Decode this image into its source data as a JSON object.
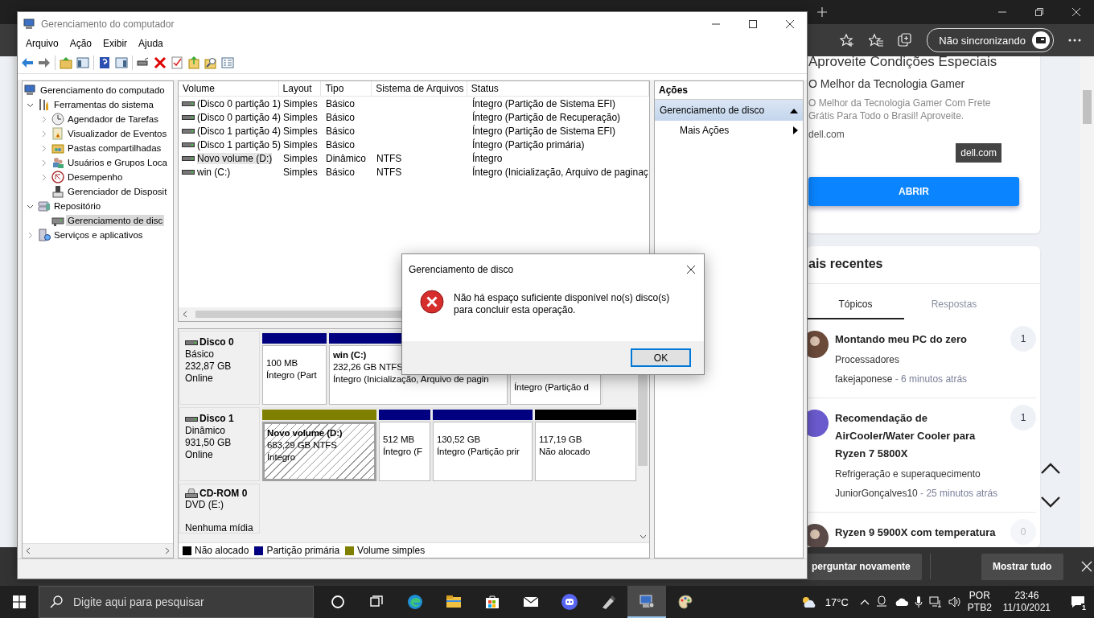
{
  "browser": {
    "sync_button": "Não sincronizando",
    "ad": {
      "title": "Aproveite Condições Especiais",
      "subtitle": "O Melhor da Tecnologia Gamer",
      "text": "O Melhor da Tecnologia Gamer Com Frete Grátis Para Todo o Brasil! Aproveite.",
      "domain": "dell.com",
      "badge": "dell.com",
      "button": "ABRIR"
    },
    "recent": {
      "heading": "ais recentes",
      "tabs": [
        {
          "label": "Tópicos",
          "selected": true
        },
        {
          "label": "Respostas",
          "selected": false
        }
      ],
      "topics": [
        {
          "title": "Montando meu PC do zero",
          "category": "Processadores",
          "author": "fakejaponese",
          "time": " - 6 minutos atrás",
          "count": "1"
        },
        {
          "title": "Recomendação de AirCooler/Water Cooler para Ryzen 7 5800X",
          "category": "Refrigeração e superaquecimento",
          "author": "JuniorGonçalves10",
          "time": " - 25 minutos atrás",
          "count": "1"
        },
        {
          "title": "Ryzen 9 5900X com temperatura",
          "count": "0"
        }
      ]
    },
    "download_bar": {
      "ask_again_button": "perguntar novamente",
      "show_all_button": "Mostrar tudo"
    }
  },
  "mmc": {
    "title": "Gerenciamento do computador",
    "menu": [
      "Arquivo",
      "Ação",
      "Exibir",
      "Ajuda"
    ],
    "tree": [
      {
        "label": "Gerenciamento do computado",
        "selected": false,
        "children": [
          {
            "label": "Ferramentas do sistema",
            "expanded": true,
            "selected": false,
            "children": [
              {
                "label": "Agendador de Tarefas",
                "expanded": false,
                "selected": false
              },
              {
                "label": "Visualizador de Eventos",
                "expanded": false,
                "selected": false
              },
              {
                "label": "Pastas compartilhadas",
                "expanded": false,
                "selected": false
              },
              {
                "label": "Usuários e Grupos Loca",
                "expanded": false,
                "selected": false
              },
              {
                "label": "Desempenho",
                "expanded": false,
                "selected": false
              },
              {
                "label": "Gerenciador de Disposit",
                "selected": false
              }
            ]
          },
          {
            "label": "Repositório",
            "expanded": true,
            "selected": false,
            "children": [
              {
                "label": "Gerenciamento de disc",
                "selected": true
              }
            ]
          },
          {
            "label": "Serviços e aplicativos",
            "expanded": false,
            "selected": false
          }
        ]
      }
    ],
    "volume_table": {
      "columns": [
        "Volume",
        "Layout",
        "Tipo",
        "Sistema de Arquivos",
        "Status"
      ],
      "rows": [
        {
          "cells": [
            "(Disco 0 partição 1)",
            "Simples",
            "Básico",
            "",
            "Íntegro (Partição de Sistema EFI)"
          ],
          "selected": false
        },
        {
          "cells": [
            "(Disco 0 partição 4)",
            "Simples",
            "Básico",
            "",
            "Íntegro (Partição de Recuperação)"
          ],
          "selected": false
        },
        {
          "cells": [
            "(Disco 1 partição 4)",
            "Simples",
            "Básico",
            "",
            "Íntegro (Partição de Sistema EFI)"
          ],
          "selected": false
        },
        {
          "cells": [
            "(Disco 1 partição 5)",
            "Simples",
            "Básico",
            "",
            "Íntegro (Partição primária)"
          ],
          "selected": false
        },
        {
          "cells": [
            "Novo volume (D:)",
            "Simples",
            "Dinâmico",
            "NTFS",
            "Íntegro"
          ],
          "selected": true
        },
        {
          "cells": [
            "win (C:)",
            "Simples",
            "Básico",
            "NTFS",
            "Íntegro (Inicialização, Arquivo de paginaç"
          ],
          "selected": false
        }
      ]
    },
    "disks": [
      {
        "kind": "disk",
        "name": "Disco 0",
        "type": "Básico",
        "size": "232,87 GB",
        "state": "Online",
        "partitions": [
          {
            "kind": "primary",
            "selected": false,
            "size": "100 MB",
            "status": "Íntegro (Part"
          },
          {
            "kind": "primary",
            "selected": false,
            "name": "win  (C:)",
            "size": "232,26 GB NTFS",
            "status": "Íntegro (Inicialização, Arquivo de pagin"
          },
          {
            "selected": false,
            "status": "Íntegro (Partição d"
          }
        ]
      },
      {
        "kind": "disk",
        "name": "Disco 1",
        "type": "Dinâmico",
        "size": "931,50 GB",
        "state": "Online",
        "partitions": [
          {
            "kind": "simple",
            "selected": true,
            "name": "Novo volume  (D:)",
            "size": "683,29 GB NTFS",
            "status": "Íntegro"
          },
          {
            "kind": "primary",
            "selected": false,
            "size": "512 MB",
            "status": "Íntegro (F"
          },
          {
            "kind": "primary",
            "selected": false,
            "size": "130,52 GB",
            "status": "Íntegro (Partição prir"
          },
          {
            "kind": "unallocated",
            "selected": false,
            "size": "117,19 GB",
            "status": "Não alocado"
          }
        ]
      },
      {
        "kind": "cdrom",
        "name": "CD-ROM 0",
        "type": "DVD (E:)",
        "state": "Nenhuma mídia"
      }
    ],
    "legend": [
      {
        "label": "Não alocado",
        "color": "#000000"
      },
      {
        "label": "Partição primária",
        "color": "#000080"
      },
      {
        "label": "Volume simples",
        "color": "#808000"
      }
    ],
    "actions": {
      "heading": "Ações",
      "sections": [
        {
          "label": "Gerenciamento de disco",
          "expanded": true,
          "items": [
            "Mais Ações"
          ]
        }
      ]
    }
  },
  "dialog": {
    "title": "Gerenciamento de disco",
    "message": "Não há espaço suficiente disponível no(s) disco(s) para concluir esta operação.",
    "button": "OK"
  },
  "taskbar": {
    "search_placeholder": "Digite aqui para pesquisar",
    "apps": [
      {
        "selected": false
      },
      {
        "selected": false
      },
      {
        "selected": false
      },
      {
        "selected": false
      },
      {
        "selected": false
      },
      {
        "selected": false
      },
      {
        "selected": false
      },
      {
        "selected": true
      },
      {
        "selected": false
      }
    ],
    "temperature": "17°C",
    "language": "POR",
    "keyboard": "PTB2",
    "time": "23:46",
    "date": "11/10/2021",
    "notification_count": "1"
  }
}
